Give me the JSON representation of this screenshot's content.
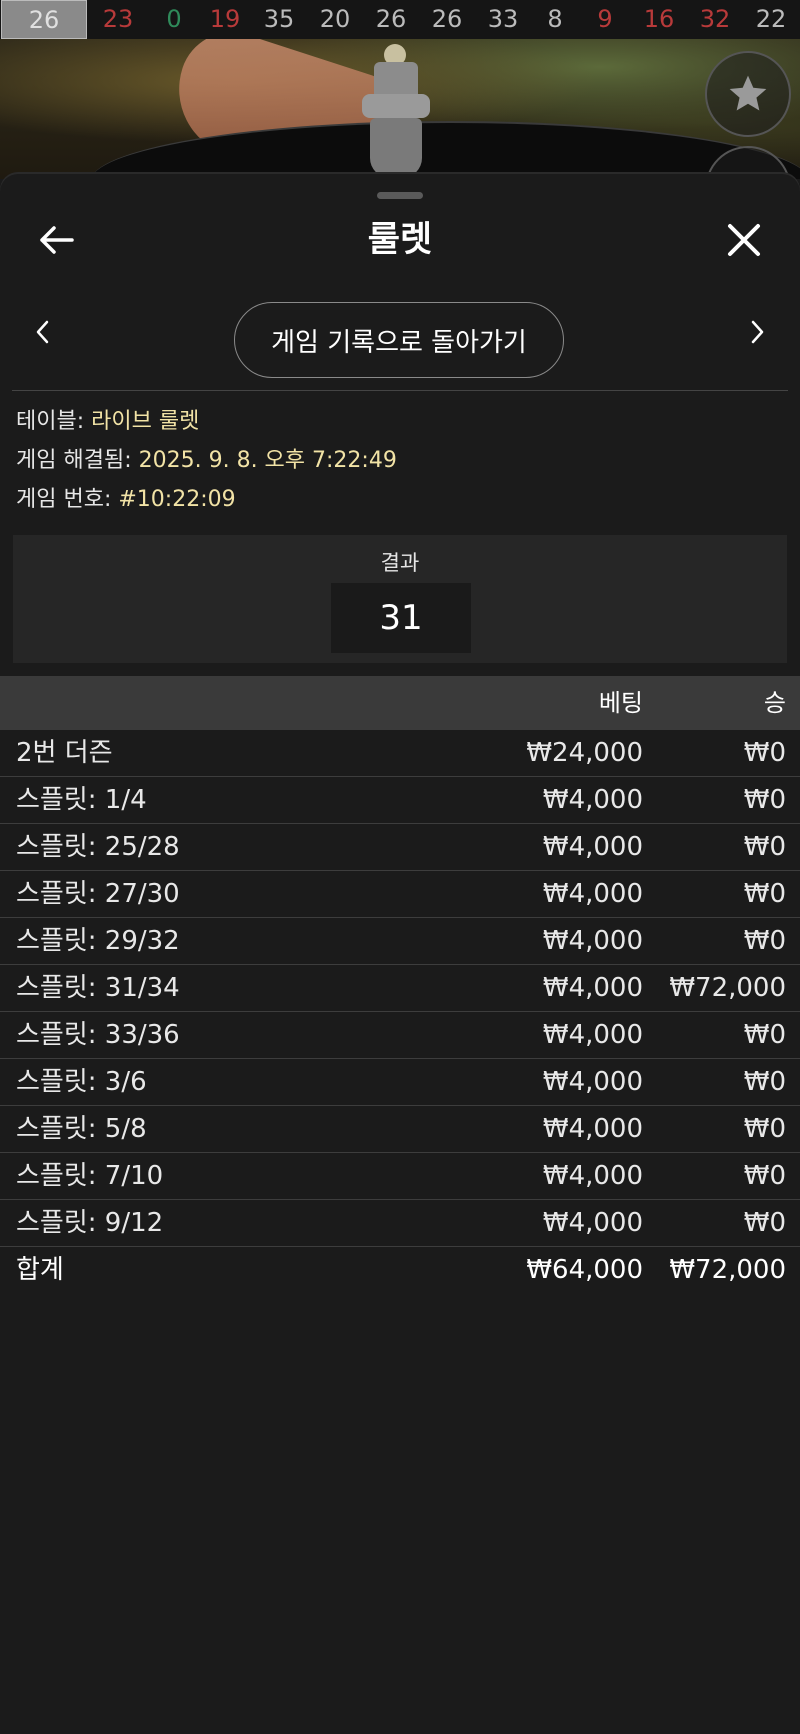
{
  "results_strip": [
    "26",
    "23",
    "0",
    "19",
    "35",
    "20",
    "26",
    "26",
    "33",
    "8",
    "9",
    "16",
    "32",
    "22"
  ],
  "results_colors": [
    "#e0e0e0",
    "#b83a3a",
    "#2f8a5a",
    "#b83a3a",
    "#bbbbbb",
    "#bbbbbb",
    "#bbbbbb",
    "#bbbbbb",
    "#bbbbbb",
    "#bbbbbb",
    "#b83a3a",
    "#b83a3a",
    "#b83a3a",
    "#bbbbbb"
  ],
  "header": {
    "title": "룰렛"
  },
  "nav": {
    "back_history_label": "게임 기록으로 돌아가기"
  },
  "info": {
    "table_label": "테이블: ",
    "table_value": "라이브 룰렛",
    "resolved_label": "게임 해결됨: ",
    "resolved_value": "2025. 9. 8. 오후 7:22:49",
    "game_no_label": "게임 번호: ",
    "game_no_value": "#10:22:09"
  },
  "result": {
    "label": "결과",
    "value": "31"
  },
  "table": {
    "col_bet": "베팅",
    "col_win": "승",
    "rows": [
      {
        "name": "2번 더즌",
        "bet": "₩24,000",
        "win": "₩0"
      },
      {
        "name": "스플릿: 1/4",
        "bet": "₩4,000",
        "win": "₩0"
      },
      {
        "name": "스플릿: 25/28",
        "bet": "₩4,000",
        "win": "₩0"
      },
      {
        "name": "스플릿: 27/30",
        "bet": "₩4,000",
        "win": "₩0"
      },
      {
        "name": "스플릿: 29/32",
        "bet": "₩4,000",
        "win": "₩0"
      },
      {
        "name": "스플릿: 31/34",
        "bet": "₩4,000",
        "win": "₩72,000"
      },
      {
        "name": "스플릿: 33/36",
        "bet": "₩4,000",
        "win": "₩0"
      },
      {
        "name": "스플릿: 3/6",
        "bet": "₩4,000",
        "win": "₩0"
      },
      {
        "name": "스플릿: 5/8",
        "bet": "₩4,000",
        "win": "₩0"
      },
      {
        "name": "스플릿: 7/10",
        "bet": "₩4,000",
        "win": "₩0"
      },
      {
        "name": "스플릿: 9/12",
        "bet": "₩4,000",
        "win": "₩0"
      }
    ],
    "total": {
      "name": "합계",
      "bet": "₩64,000",
      "win": "₩72,000"
    }
  },
  "icons": {
    "back": "arrow-left-icon",
    "close": "close-icon",
    "prev": "chevron-left-icon",
    "next": "chevron-right-icon",
    "favorite": "star-icon"
  }
}
